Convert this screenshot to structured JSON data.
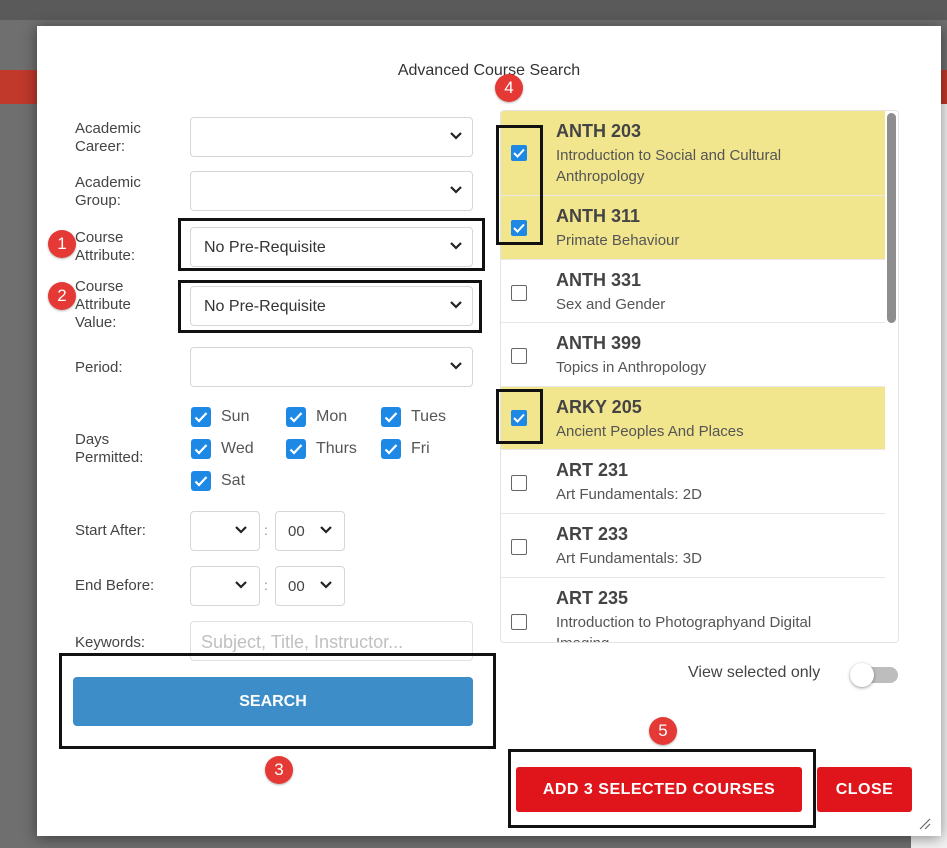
{
  "dialog": {
    "title": "Advanced Course Search"
  },
  "form": {
    "academic_career": {
      "label": "Academic\nCareer:",
      "value": ""
    },
    "academic_group": {
      "label": "Academic\nGroup:",
      "value": ""
    },
    "course_attribute": {
      "label": "Course\nAttribute:",
      "value": "No Pre-Requisite"
    },
    "course_attribute_value": {
      "label": "Course\nAttribute\nValue:",
      "value": "No Pre-Requisite"
    },
    "period": {
      "label": "Period:",
      "value": ""
    },
    "days": {
      "label": "Days\nPermitted:",
      "items": [
        {
          "label": "Sun",
          "checked": true
        },
        {
          "label": "Mon",
          "checked": true
        },
        {
          "label": "Tues",
          "checked": true
        },
        {
          "label": "Wed",
          "checked": true
        },
        {
          "label": "Thurs",
          "checked": true
        },
        {
          "label": "Fri",
          "checked": true
        },
        {
          "label": "Sat",
          "checked": true
        }
      ]
    },
    "start_after": {
      "label": "Start After:",
      "hour": "",
      "minute": "00"
    },
    "end_before": {
      "label": "End Before:",
      "hour": "",
      "minute": "00"
    },
    "keywords": {
      "label": "Keywords:",
      "placeholder": "Subject, Title, Instructor..."
    },
    "search_label": "SEARCH"
  },
  "courses": [
    {
      "code": "ANTH 203",
      "title": "Introduction to Social and Cultural Anthropology",
      "selected": true
    },
    {
      "code": "ANTH 311",
      "title": "Primate Behaviour",
      "selected": true
    },
    {
      "code": "ANTH 331",
      "title": "Sex and Gender",
      "selected": false
    },
    {
      "code": "ANTH 399",
      "title": "Topics in Anthropology",
      "selected": false
    },
    {
      "code": "ARKY 205",
      "title": "Ancient Peoples And Places",
      "selected": true
    },
    {
      "code": "ART 231",
      "title": "Art Fundamentals: 2D",
      "selected": false
    },
    {
      "code": "ART 233",
      "title": "Art Fundamentals: 3D",
      "selected": false
    },
    {
      "code": "ART 235",
      "title": "Introduction to Photographyand Digital Imaging",
      "selected": false
    }
  ],
  "view_selected_only": {
    "label": "View selected only",
    "on": false
  },
  "footer": {
    "add_label": "ADD 3 SELECTED COURSES",
    "close_label": "CLOSE"
  },
  "badges": [
    "1",
    "2",
    "3",
    "4",
    "5"
  ],
  "colors": {
    "selected_row": "#f1e58d",
    "search_button": "#3d8dc9",
    "action_red": "#e0151b",
    "badge": "#e53935",
    "checkbox": "#1e88e5"
  }
}
